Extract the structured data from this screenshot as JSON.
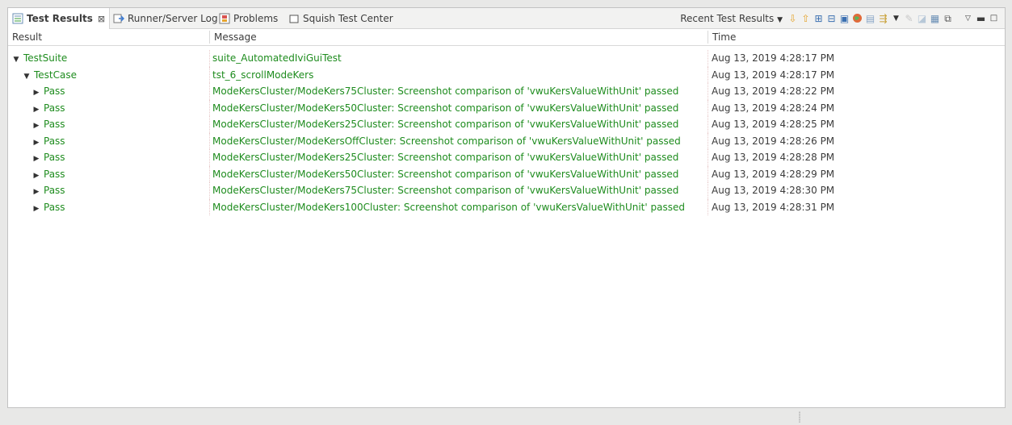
{
  "tabs": [
    {
      "label": "Test Results",
      "icon": "test-results-icon",
      "active": true
    },
    {
      "label": "Runner/Server Log",
      "icon": "runner-log-icon"
    },
    {
      "label": "Problems",
      "icon": "problems-icon"
    },
    {
      "label": "Squish Test Center",
      "icon": "squish-test-center-icon"
    }
  ],
  "toolbar": {
    "recent_label": "Recent Test Results",
    "icons": [
      "next-arrow-down-icon",
      "previous-arrow-up-icon",
      "expand-all-icon",
      "collapse-all-icon",
      "show-details-icon",
      "globe-icon",
      "report-icon",
      "filter-icon",
      "filter-dropdown-icon",
      "edit-icon",
      "export-icon",
      "chart-icon",
      "open-external-icon",
      "view-menu-icon",
      "minimize-icon",
      "maximize-icon"
    ]
  },
  "columns": {
    "result": "Result",
    "message": "Message",
    "time": "Time"
  },
  "rows": [
    {
      "result": "TestSuite",
      "message": "suite_AutomatedIviGuiTest",
      "time": "Aug 13, 2019 4:28:17 PM",
      "level": 0,
      "expanded": true
    },
    {
      "result": "TestCase",
      "message": "tst_6_scrollModeKers",
      "time": "Aug 13, 2019 4:28:17 PM",
      "level": 1,
      "expanded": true
    },
    {
      "result": "Pass",
      "message": "ModeKersCluster/ModeKers75Cluster: Screenshot comparison of 'vwuKersValueWithUnit' passed",
      "time": "Aug 13, 2019 4:28:22 PM",
      "level": 2,
      "expanded": false
    },
    {
      "result": "Pass",
      "message": "ModeKersCluster/ModeKers50Cluster: Screenshot comparison of 'vwuKersValueWithUnit' passed",
      "time": "Aug 13, 2019 4:28:24 PM",
      "level": 2,
      "expanded": false
    },
    {
      "result": "Pass",
      "message": "ModeKersCluster/ModeKers25Cluster: Screenshot comparison of 'vwuKersValueWithUnit' passed",
      "time": "Aug 13, 2019 4:28:25 PM",
      "level": 2,
      "expanded": false
    },
    {
      "result": "Pass",
      "message": "ModeKersCluster/ModeKersOffCluster: Screenshot comparison of 'vwuKersValueWithUnit' passed",
      "time": "Aug 13, 2019 4:28:26 PM",
      "level": 2,
      "expanded": false
    },
    {
      "result": "Pass",
      "message": "ModeKersCluster/ModeKers25Cluster: Screenshot comparison of 'vwuKersValueWithUnit' passed",
      "time": "Aug 13, 2019 4:28:28 PM",
      "level": 2,
      "expanded": false
    },
    {
      "result": "Pass",
      "message": "ModeKersCluster/ModeKers50Cluster: Screenshot comparison of 'vwuKersValueWithUnit' passed",
      "time": "Aug 13, 2019 4:28:29 PM",
      "level": 2,
      "expanded": false
    },
    {
      "result": "Pass",
      "message": "ModeKersCluster/ModeKers75Cluster: Screenshot comparison of 'vwuKersValueWithUnit' passed",
      "time": "Aug 13, 2019 4:28:30 PM",
      "level": 2,
      "expanded": false
    },
    {
      "result": "Pass",
      "message": "ModeKersCluster/ModeKers100Cluster: Screenshot comparison of 'vwuKersValueWithUnit' passed",
      "time": "Aug 13, 2019 4:28:31 PM",
      "level": 2,
      "expanded": false
    }
  ],
  "colors": {
    "pass_text": "#1e8c1e",
    "text": "#3c3c3c",
    "background": "#ffffff"
  }
}
